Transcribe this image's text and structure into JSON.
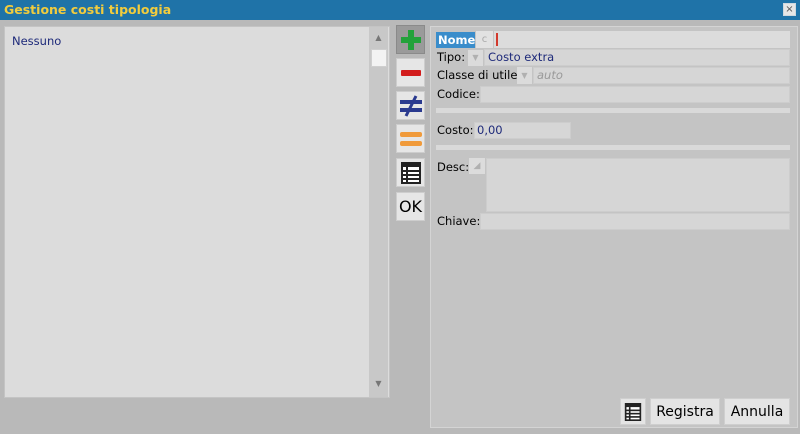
{
  "window": {
    "title": "Gestione costi tipologia",
    "close_glyph": "×"
  },
  "list": {
    "items": [
      "Nessuno"
    ]
  },
  "toolbar": {
    "add_icon": "plus-icon",
    "remove_icon": "minus-icon",
    "not_equal_icon": "not-equal-icon",
    "equal_icon": "equal-icon",
    "grid_icon": "table-icon",
    "ok_label": "OK"
  },
  "form": {
    "nome": {
      "label": "Nome:",
      "prefix": "c",
      "value": ""
    },
    "tipo": {
      "label": "Tipo:",
      "value": "Costo extra"
    },
    "classe_di_utile": {
      "label": "Classe di utile:",
      "value": "auto"
    },
    "codice": {
      "label": "Codice:",
      "value": ""
    },
    "costo": {
      "label": "Costo:",
      "value": "0,00"
    },
    "desc": {
      "label": "Desc:",
      "value": ""
    },
    "chiave": {
      "label": "Chiave:",
      "value": ""
    }
  },
  "buttons": {
    "registra": "Registra",
    "annulla": "Annulla"
  },
  "colors": {
    "titlebar": "#1f73a8",
    "title_text": "#f2cc3d",
    "add_green": "#22a23a",
    "remove_red": "#d21c1c",
    "neq_blue": "#2a3a8f",
    "eq_orange": "#f09a3a",
    "value_text": "#1e2a7a"
  }
}
